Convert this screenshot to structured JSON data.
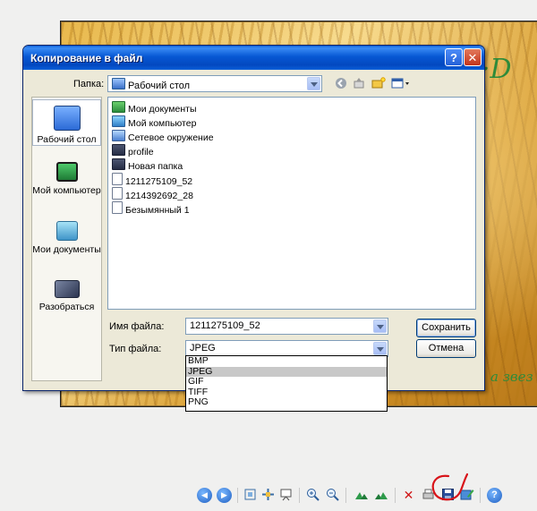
{
  "background": {
    "text_right_top": "·D",
    "text_right_bottom": "а звез"
  },
  "dialog": {
    "title": "Копирование в файл",
    "help_label": "?",
    "close_label": "✕",
    "folder_label": "Папка:",
    "folder_value": "Рабочий стол",
    "places": [
      {
        "label": "Рабочий стол",
        "icon": "desktop-icon"
      },
      {
        "label": "Мой компьютер",
        "icon": "my-computer-icon"
      },
      {
        "label": "Мои документы",
        "icon": "my-documents-icon"
      },
      {
        "label": "Разобраться",
        "icon": "network-place-icon"
      }
    ],
    "files": [
      {
        "name": "Мои документы",
        "icon": "my-documents-icon"
      },
      {
        "name": "Мой компьютер",
        "icon": "my-computer-icon"
      },
      {
        "name": "Сетевое окружение",
        "icon": "network-icon"
      },
      {
        "name": "profile",
        "icon": "folder-icon"
      },
      {
        "name": "Новая папка",
        "icon": "folder-icon"
      },
      {
        "name": "1211275109_52",
        "icon": "file-icon"
      },
      {
        "name": "1214392692_28",
        "icon": "file-icon"
      },
      {
        "name": "Безымянный 1",
        "icon": "file-icon"
      }
    ],
    "filename_label": "Имя файла:",
    "filename_value": "1211275109_52",
    "filetype_label": "Тип файла:",
    "filetype_value": "JPEG",
    "save_label": "Сохранить",
    "cancel_label": "Отмена",
    "filetype_options": [
      "BMP",
      "JPEG",
      "GIF",
      "TIFF",
      "PNG"
    ],
    "filetype_selected": "JPEG"
  },
  "toolbar": {
    "tools": [
      "previous-icon",
      "next-icon",
      "best-fit-icon",
      "actual-size-icon",
      "slideshow-icon",
      "zoom-in-icon",
      "zoom-out-icon",
      "rotate-clockwise-icon",
      "rotate-counterclockwise-icon",
      "delete-icon",
      "print-icon",
      "save-icon",
      "edit-icon",
      "help-icon"
    ]
  },
  "colors": {
    "title_bar": "#0758d4",
    "close_button": "#c4341b",
    "photo_text": "#2e8b3a",
    "annotation": "#d8141a"
  }
}
